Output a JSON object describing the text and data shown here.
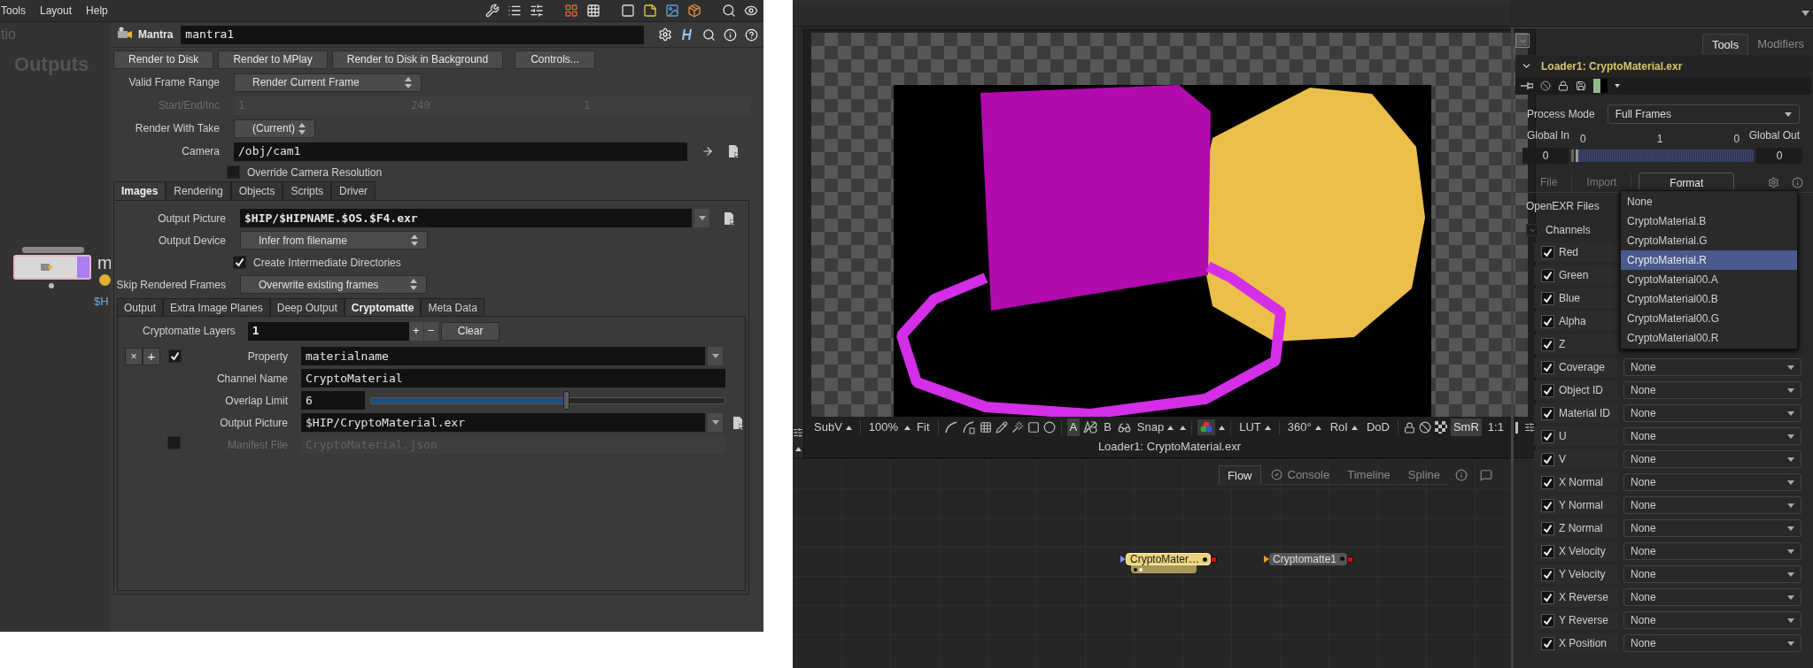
{
  "houdini": {
    "menu": [
      "Tools",
      "Layout",
      "Help"
    ],
    "network": {
      "faded_label": "tio",
      "title": "Outputs",
      "node_name": "m",
      "node_path": "$H"
    },
    "node_type": "Mantra",
    "node_name": "mantra1",
    "buttons": [
      "Render to Disk",
      "Render to MPlay",
      "Render to Disk in Background",
      "Controls..."
    ],
    "params": [
      {
        "kind": "dropdown",
        "label": "Valid Frame Range",
        "value": "Render Current Frame",
        "disabled": false
      },
      {
        "kind": "triple",
        "label": "Start/End/Inc",
        "values": [
          "1",
          "240",
          "1"
        ],
        "disabled": true
      },
      {
        "kind": "dropdown",
        "label": "Render With Take",
        "value": "(Current)",
        "disabled": false
      },
      {
        "kind": "path",
        "label": "Camera",
        "value": "/obj/cam1",
        "disabled": false
      },
      {
        "kind": "toggle",
        "label": "Override Camera Resolution",
        "checked": false,
        "disabled": false
      }
    ],
    "tabs": [
      {
        "label": "Images",
        "selected": true
      },
      {
        "label": "Rendering",
        "selected": false
      },
      {
        "label": "Objects",
        "selected": false
      },
      {
        "label": "Scripts",
        "selected": false
      },
      {
        "label": "Driver",
        "selected": false
      }
    ],
    "image_params": [
      {
        "kind": "file",
        "label": "Output Picture",
        "value": "$HIP/$HIPNAME.$OS.$F4.exr",
        "disabled": false
      },
      {
        "kind": "dropdown",
        "label": "Output Device",
        "value": "Infer from filename",
        "disabled": false
      },
      {
        "kind": "toggle",
        "label": "Create Intermediate Directories",
        "checked": true,
        "disabled": false
      },
      {
        "kind": "dropdown",
        "label": "Skip Rendered Frames",
        "value": "Overwrite existing frames",
        "disabled": false
      }
    ],
    "subtabs": [
      {
        "label": "Output",
        "selected": false
      },
      {
        "label": "Extra Image Planes",
        "selected": false
      },
      {
        "label": "Deep Output",
        "selected": false
      },
      {
        "label": "Cryptomatte",
        "selected": true
      },
      {
        "label": "Meta Data",
        "selected": false
      }
    ],
    "crypto": {
      "layers_label": "Cryptomatte Layers",
      "layers": "1",
      "add": "+",
      "remove": "−",
      "clear": "Clear",
      "remove_layer": "×",
      "insert_layer": "+",
      "enabled": true,
      "rows": [
        {
          "kind": "menu",
          "label": "Property",
          "value": "materialname",
          "disabled": false
        },
        {
          "kind": "text",
          "label": "Channel Name",
          "value": "CryptoMaterial",
          "disabled": false
        },
        {
          "kind": "slider",
          "label": "Overlap Limit",
          "value": "6",
          "level": 0.55,
          "disabled": false
        },
        {
          "kind": "file",
          "label": "Output Picture",
          "value": "$HIP/CryptoMaterial.exr",
          "disabled": false
        },
        {
          "kind": "toggle_text",
          "label": "Manifest File",
          "value": "CryptoMaterial.json",
          "checked": false,
          "disabled": true
        }
      ]
    }
  },
  "fusion": {
    "viewer": {
      "subv": "SubV",
      "zoom": "100%",
      "fit": "Fit",
      "a": "A",
      "a_selected": true,
      "b": "B",
      "snap": "Snap",
      "lut": "LUT",
      "angle": "360°",
      "roi": "RoI",
      "dod": "DoD",
      "smr": "SmR",
      "ratio": "1:1",
      "caption": "Loader1: CryptoMaterial.exr"
    },
    "flow_tabs": [
      {
        "label": "Flow",
        "selected": true
      },
      {
        "label": "Console",
        "selected": false
      },
      {
        "label": "Timeline",
        "selected": false
      },
      {
        "label": "Spline",
        "selected": false
      }
    ],
    "nodes": [
      {
        "kind": "loader",
        "label": "CryptoMater…"
      },
      {
        "kind": "tool",
        "label": "Cryptomatte1"
      }
    ],
    "inspector": {
      "tabs": [
        {
          "label": "Tools",
          "selected": true
        },
        {
          "label": "Modifiers",
          "selected": false
        }
      ],
      "tool_name": "Loader1: CryptoMaterial.exr",
      "process_mode_label": "Process Mode",
      "process_mode": "Full Frames",
      "global_in_label": "Global In",
      "global_out_label": "Global Out",
      "ticks": [
        "0",
        "1",
        "0"
      ],
      "global_in": "0",
      "global_out": "0",
      "range": {
        "level": 0
      },
      "subtabs": [
        {
          "label": "File",
          "selected": false
        },
        {
          "label": "Import",
          "selected": false
        },
        {
          "label": "Format",
          "selected": true
        }
      ],
      "section": "OpenEXR Files",
      "group": "Channels",
      "group_expanded": true,
      "channels": [
        {
          "label": "Red",
          "checked": true
        },
        {
          "label": "Green",
          "checked": true
        },
        {
          "label": "Blue",
          "checked": true
        },
        {
          "label": "Alpha",
          "checked": true
        },
        {
          "label": "Z",
          "checked": true
        },
        {
          "label": "Coverage",
          "checked": true,
          "value": "None"
        },
        {
          "label": "Object ID",
          "checked": true,
          "value": "None"
        },
        {
          "label": "Material ID",
          "checked": true,
          "value": "None"
        },
        {
          "label": "U",
          "checked": true,
          "value": "None"
        },
        {
          "label": "V",
          "checked": true,
          "value": "None"
        },
        {
          "label": "X Normal",
          "checked": true,
          "value": "None"
        },
        {
          "label": "Y Normal",
          "checked": true,
          "value": "None"
        },
        {
          "label": "Z Normal",
          "checked": true,
          "value": "None"
        },
        {
          "label": "X Velocity",
          "checked": true,
          "value": "None"
        },
        {
          "label": "Y Velocity",
          "checked": true,
          "value": "None"
        },
        {
          "label": "X Reverse",
          "checked": true,
          "value": "None"
        },
        {
          "label": "Y Reverse",
          "checked": true,
          "value": "None"
        },
        {
          "label": "X Position",
          "checked": true,
          "value": "None"
        }
      ],
      "menu": [
        {
          "label": "None",
          "selected": false
        },
        {
          "label": "CryptoMaterial.B",
          "selected": false
        },
        {
          "label": "CryptoMaterial.G",
          "selected": false
        },
        {
          "label": "CryptoMaterial.R",
          "selected": true
        },
        {
          "label": "CryptoMaterial00.A",
          "selected": false
        },
        {
          "label": "CryptoMaterial00.B",
          "selected": false
        },
        {
          "label": "CryptoMaterial00.G",
          "selected": false
        },
        {
          "label": "CryptoMaterial00.R",
          "selected": false
        }
      ]
    }
  }
}
